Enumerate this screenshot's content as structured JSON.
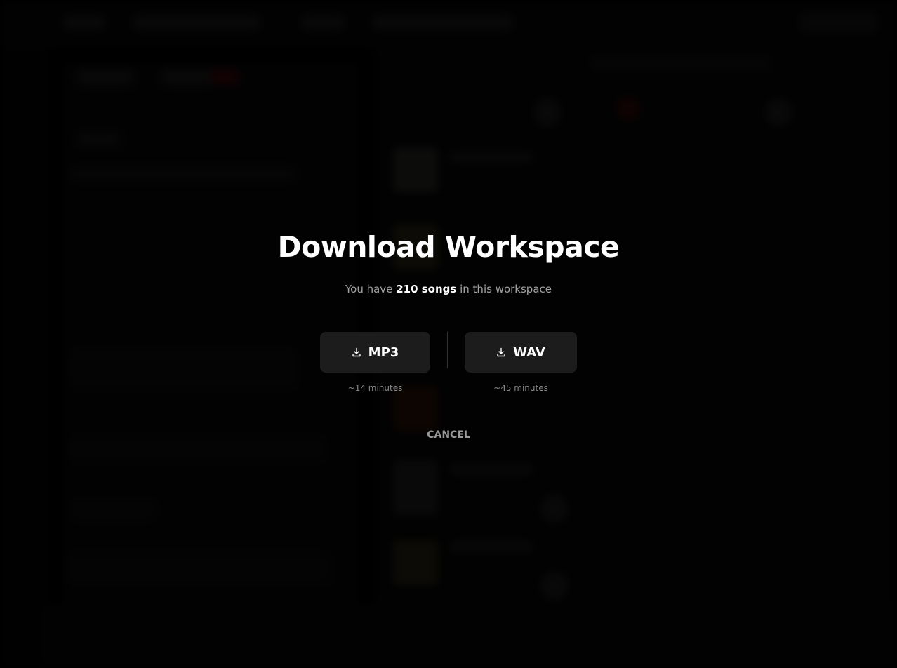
{
  "modal": {
    "title": "Download Workspace",
    "subtitle_prefix": "You have",
    "song_count": "210 songs",
    "subtitle_suffix": "in this workspace",
    "options": [
      {
        "label": "MP3",
        "estimate": "~14 minutes",
        "icon": "download-icon"
      },
      {
        "label": "WAV",
        "estimate": "~45 minutes",
        "icon": "download-icon"
      }
    ],
    "cancel_label": "CANCEL"
  },
  "colors": {
    "background": "#000000",
    "button_bg": "#1c1c1c",
    "text_primary": "#ffffff",
    "text_muted": "#a3a3a3"
  }
}
